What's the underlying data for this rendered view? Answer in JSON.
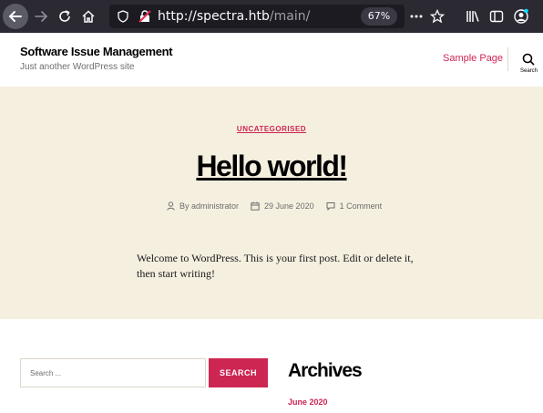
{
  "browser": {
    "url_host": "http://spectra.htb",
    "url_path": "/main/",
    "zoom": "67%"
  },
  "site": {
    "title": "Software Issue Management",
    "description": "Just another WordPress site",
    "nav_link": "Sample Page",
    "search_label": "Search"
  },
  "post": {
    "category": "UNCATEGORISED",
    "title": "Hello world!",
    "author": "By administrator",
    "date": "29 June 2020",
    "comments": "1 Comment",
    "body": "Welcome to WordPress. This is your first post. Edit or delete it, then start writing!"
  },
  "widgets": {
    "search_placeholder": "Search ...",
    "search_button": "SEARCH",
    "archives_title": "Archives",
    "archive_item": "June 2020"
  },
  "colors": {
    "accent": "#cd2653",
    "hero_bg": "#f5efe0",
    "toolbar_bg": "#2b2a33"
  }
}
